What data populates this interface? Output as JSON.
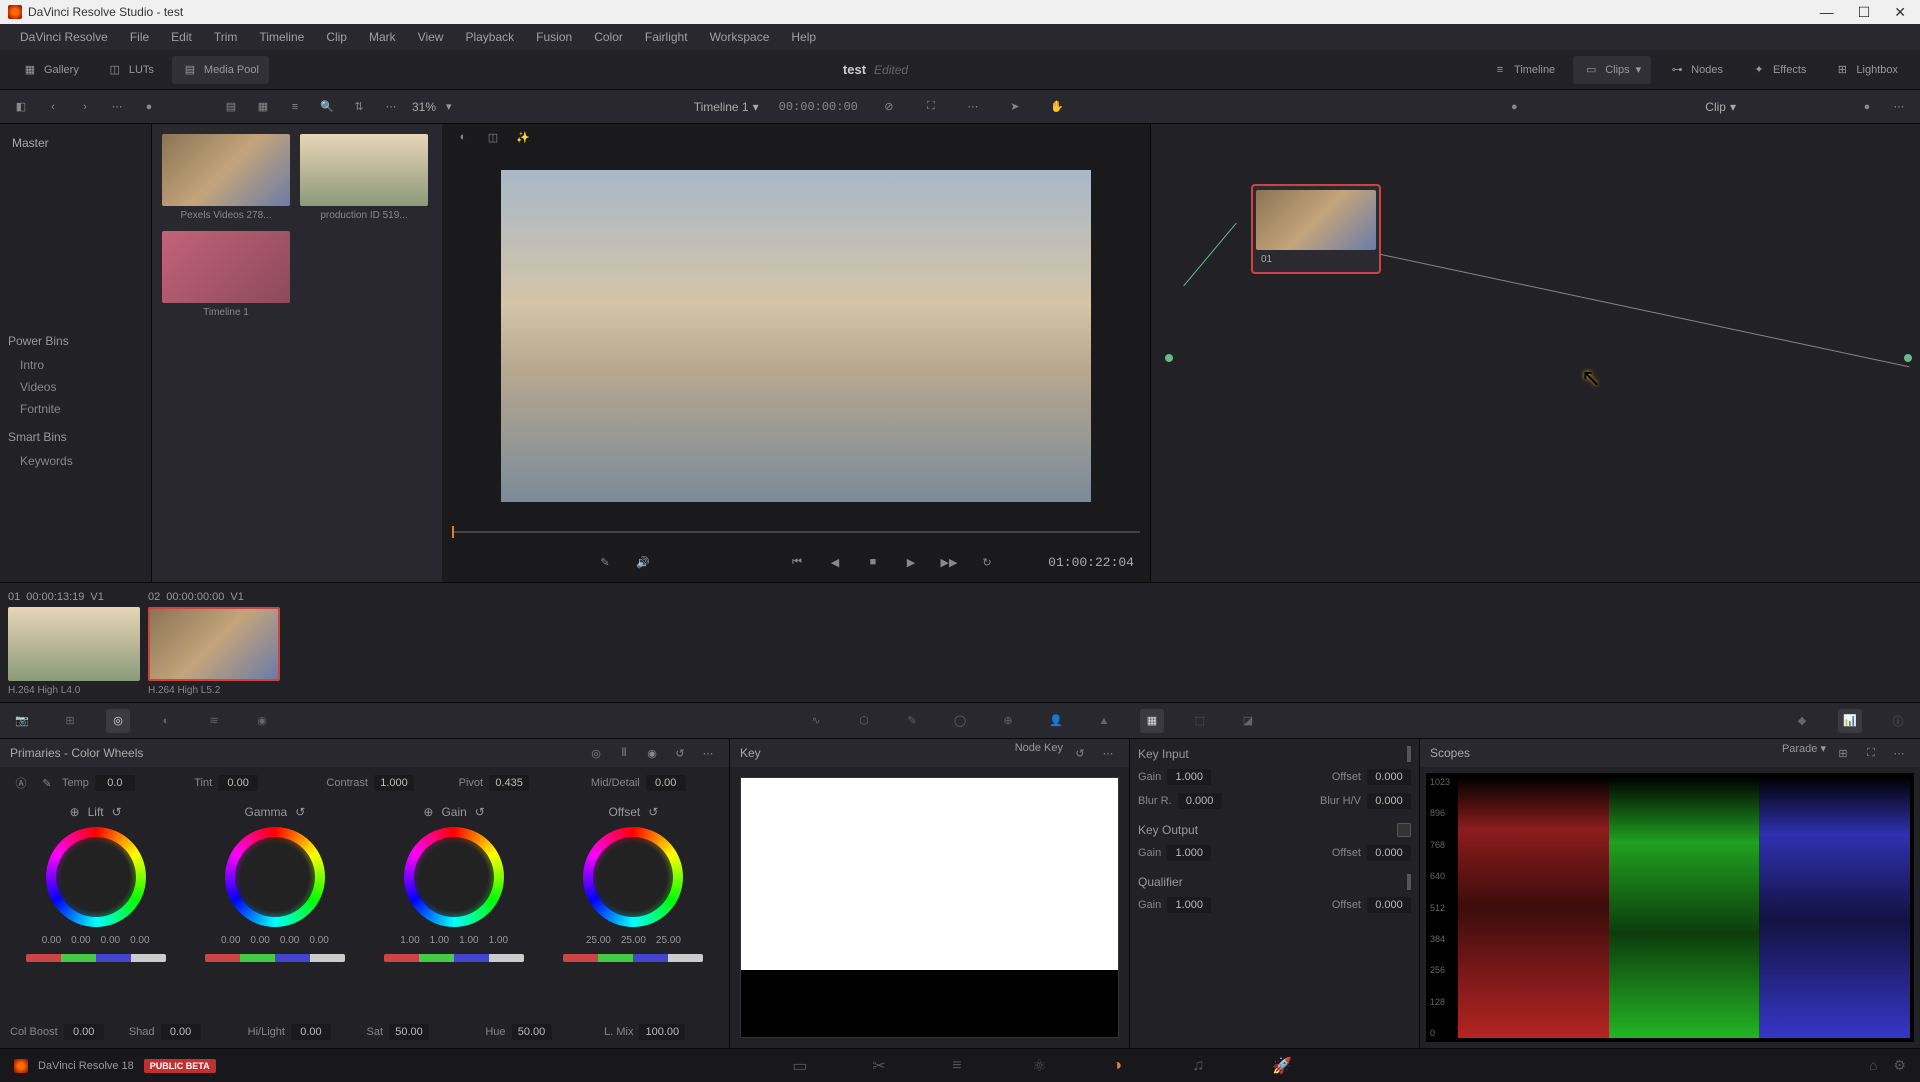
{
  "window": {
    "title": "DaVinci Resolve Studio - test"
  },
  "menu": [
    "DaVinci Resolve",
    "File",
    "Edit",
    "Trim",
    "Timeline",
    "Clip",
    "Mark",
    "View",
    "Playback",
    "Fusion",
    "Color",
    "Fairlight",
    "Workspace",
    "Help"
  ],
  "toolbar": {
    "gallery": "Gallery",
    "luts": "LUTs",
    "mediapool": "Media Pool",
    "project": "test",
    "edited": "Edited",
    "timeline": "Timeline",
    "clips": "Clips",
    "nodes": "Nodes",
    "effects": "Effects",
    "lightbox": "Lightbox"
  },
  "subbar": {
    "zoom": "31%",
    "timeline_name": "Timeline 1",
    "timecode": "00:00:00:00",
    "clip_label": "Clip"
  },
  "mediapool": {
    "master": "Master",
    "powerbins": "Power Bins",
    "bins": [
      "Intro",
      "Videos",
      "Fortnite"
    ],
    "smartbins": "Smart Bins",
    "keywords": "Keywords"
  },
  "thumbs": [
    {
      "name": "Pexels Videos 278..."
    },
    {
      "name": "production ID 519..."
    },
    {
      "name": "Timeline 1"
    }
  ],
  "node": {
    "label": "01"
  },
  "viewer": {
    "timecode": "01:00:22:04"
  },
  "clips": [
    {
      "idx": "01",
      "tc": "00:00:13:19",
      "track": "V1",
      "codec": "H.264 High L4.0",
      "selected": false
    },
    {
      "idx": "02",
      "tc": "00:00:00:00",
      "track": "V1",
      "codec": "H.264 High L5.2",
      "selected": true
    }
  ],
  "primaries": {
    "title": "Primaries - Color Wheels",
    "params_top": {
      "temp": "0.0",
      "tint": "0.00",
      "contrast": "1.000",
      "pivot": "0.435",
      "mid": "0.00"
    },
    "wheels": {
      "lift": {
        "label": "Lift",
        "vals": [
          "0.00",
          "0.00",
          "0.00",
          "0.00"
        ]
      },
      "gamma": {
        "label": "Gamma",
        "vals": [
          "0.00",
          "0.00",
          "0.00",
          "0.00"
        ]
      },
      "gain": {
        "label": "Gain",
        "vals": [
          "1.00",
          "1.00",
          "1.00",
          "1.00"
        ]
      },
      "offset": {
        "label": "Offset",
        "vals": [
          "25.00",
          "25.00",
          "25.00"
        ]
      }
    },
    "params_bottom": {
      "colboost": "0.00",
      "shad": "0.00",
      "hilight": "0.00",
      "sat": "50.00",
      "hue": "50.00",
      "lmix": "100.00"
    },
    "labels": {
      "temp": "Temp",
      "tint": "Tint",
      "contrast": "Contrast",
      "pivot": "Pivot",
      "mid": "Mid/Detail",
      "colboost": "Col Boost",
      "shad": "Shad",
      "hilight": "Hi/Light",
      "sat": "Sat",
      "hue": "Hue",
      "lmix": "L. Mix"
    }
  },
  "key": {
    "title": "Key",
    "nodekey": "Node Key",
    "input": {
      "title": "Key Input",
      "gain": "1.000",
      "offset": "0.000",
      "blurr": "0.000",
      "blurh": "0.000"
    },
    "output": {
      "title": "Key Output",
      "gain": "1.000",
      "offset": "0.000"
    },
    "qualifier": {
      "title": "Qualifier",
      "gain": "1.000",
      "offset": "0.000"
    },
    "labels": {
      "gain": "Gain",
      "offset": "Offset",
      "blurr": "Blur R.",
      "blurh": "Blur H/V"
    }
  },
  "scopes": {
    "title": "Scopes",
    "mode": "Parade",
    "levels": [
      "1023",
      "896",
      "768",
      "640",
      "512",
      "384",
      "256",
      "128",
      "0"
    ]
  },
  "footer": {
    "version": "DaVinci Resolve 18",
    "beta": "PUBLIC BETA"
  }
}
